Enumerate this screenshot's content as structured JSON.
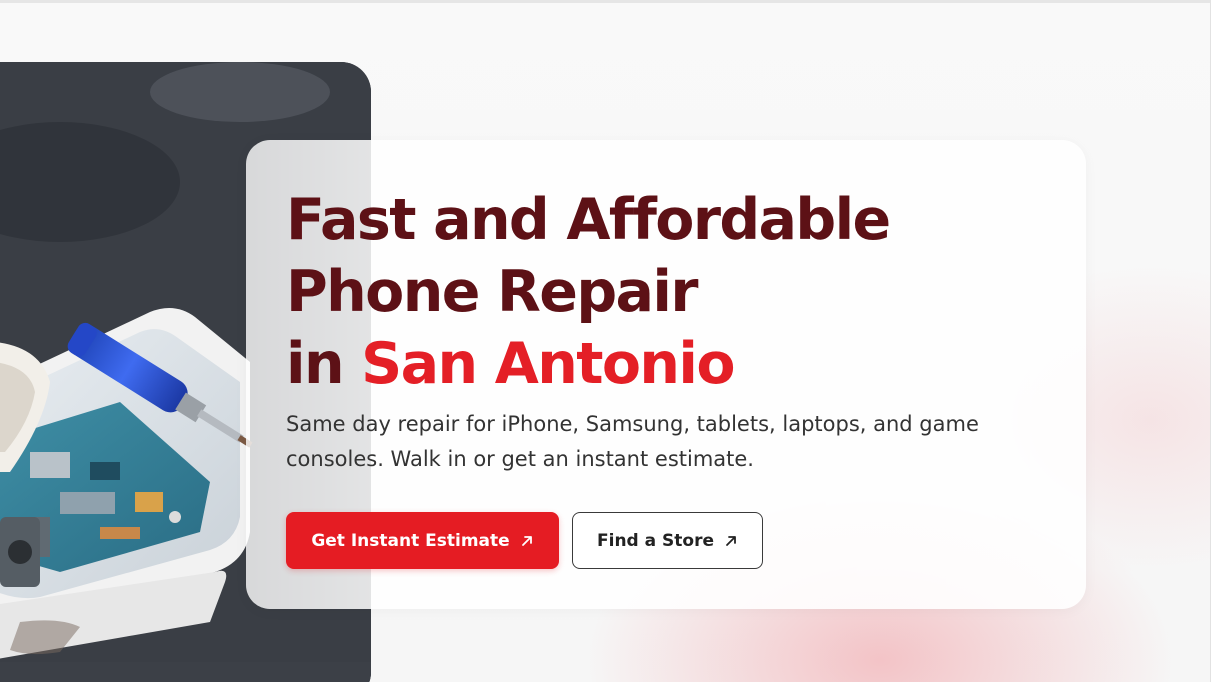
{
  "hero": {
    "title_line1": "Fast and Affordable",
    "title_line2": "Phone Repair",
    "title_line3_prefix": "in ",
    "title_line3_accent": "San Antonio",
    "subtitle": "Same day repair for iPhone, Samsung, tablets, laptops, and game consoles. Walk in or get an instant estimate.",
    "primary_button_label": "Get Instant Estimate",
    "secondary_button_label": "Find a Store",
    "button_icon": "arrow-up-right-icon",
    "image_subject": "phone-repair-photo"
  },
  "colors": {
    "title": "#5d1116",
    "accent": "#e41f26",
    "primary_button": "#e51c23",
    "body_text": "#333333"
  }
}
